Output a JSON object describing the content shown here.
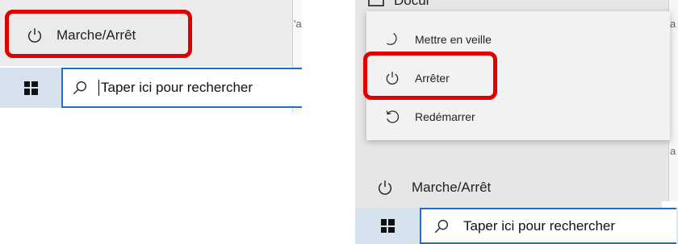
{
  "left": {
    "power_label": "Marche/Arrêt",
    "search_placeholder": "Taper ici pour rechercher",
    "clipped_text": "'a"
  },
  "right": {
    "documents_label": "Documents",
    "menu_items": [
      {
        "label": "Mettre en veille",
        "icon": "moon-icon"
      },
      {
        "label": "Arrêter",
        "icon": "power-icon"
      },
      {
        "label": "Redémarrer",
        "icon": "restart-icon"
      }
    ],
    "power_label": "Marche/Arrêt",
    "search_placeholder": "Taper ici pour rechercher",
    "clipped_text": "a"
  },
  "colors": {
    "highlight": "#e00000",
    "search_border": "#1f6fc6",
    "taskbar_bg": "#dde8f2"
  }
}
